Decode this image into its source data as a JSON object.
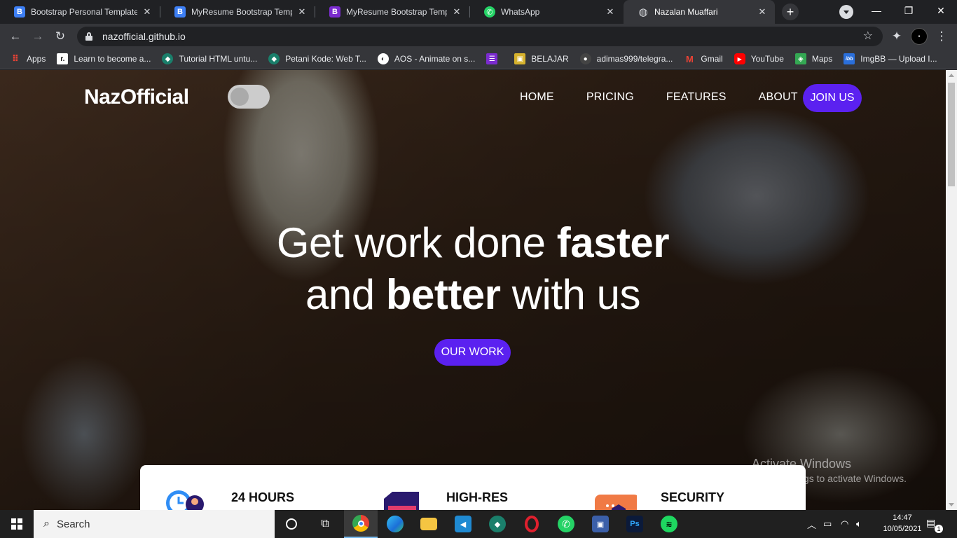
{
  "browser": {
    "tabs": [
      {
        "title": "Bootstrap Personal Templates",
        "favicon": "bootstrap-b-icon",
        "color": "#3d7ff5",
        "glyph": "B"
      },
      {
        "title": "MyResume Bootstrap Templa",
        "favicon": "bootstrap-b-icon",
        "color": "#3d7ff5",
        "glyph": "B"
      },
      {
        "title": "MyResume Bootstrap Templa",
        "favicon": "bootstrap-purple-icon",
        "color": "#7b2bcf",
        "glyph": "B"
      },
      {
        "title": "WhatsApp",
        "favicon": "whatsapp-icon",
        "color": "#25d366",
        "glyph": "✆"
      },
      {
        "title": "Nazalan Muaffari",
        "favicon": "globe-icon",
        "color": "#9aa0a6",
        "glyph": "◍"
      }
    ],
    "new_tab": "+",
    "window_controls": {
      "minimize": "—",
      "maximize": "❐",
      "close": "✕"
    },
    "url": "nazofficial.github.io",
    "bookmarks": [
      {
        "label": "Apps",
        "icon": "apps-grid-icon",
        "color": "#ea4335",
        "glyph": "⠿"
      },
      {
        "label": "Learn to become a...",
        "icon": "roadmap-icon",
        "color": "#111111",
        "glyph": "r."
      },
      {
        "label": "Tutorial HTML untu...",
        "icon": "petanikode-icon",
        "color": "#1a7f6b",
        "glyph": "◆"
      },
      {
        "label": "Petani Kode: Web T...",
        "icon": "petanikode-icon",
        "color": "#1a7f6b",
        "glyph": "◆"
      },
      {
        "label": "AOS - Animate on s...",
        "icon": "aos-icon",
        "color": "#555555",
        "glyph": "◐"
      },
      {
        "label": "",
        "icon": "list-icon",
        "color": "#7b2bcf",
        "glyph": "☰"
      },
      {
        "label": "BELAJAR",
        "icon": "folder-icon",
        "color": "#d6b22d",
        "glyph": "▣"
      },
      {
        "label": "adimas999/telegra...",
        "icon": "github-icon",
        "color": "#333333",
        "glyph": "●"
      },
      {
        "label": "Gmail",
        "icon": "gmail-icon",
        "color": "#ea4335",
        "glyph": "M"
      },
      {
        "label": "YouTube",
        "icon": "youtube-icon",
        "color": "#ff0000",
        "glyph": "▶"
      },
      {
        "label": "Maps",
        "icon": "maps-icon",
        "color": "#34a853",
        "glyph": "◈"
      },
      {
        "label": "ImgBB — Upload I...",
        "icon": "imgbb-icon",
        "color": "#2a6fdb",
        "glyph": "ibb"
      }
    ]
  },
  "site": {
    "brand": "NazOfficial",
    "nav": [
      "HOME",
      "PRICING",
      "FEATURES",
      "ABOUT"
    ],
    "join_label": "JOIN US",
    "hero": {
      "line1_light": "Get work done ",
      "line1_bold": "faster",
      "line2_a": "and ",
      "line2_bold": "better",
      "line2_b": " with us"
    },
    "cta_label": "OUR WORK",
    "features": [
      {
        "title": "24 HOURS",
        "icon": "clock-user-icon"
      },
      {
        "title": "HIGH-RES",
        "icon": "layers-icon"
      },
      {
        "title": "SECURITY",
        "icon": "shield-briefcase-icon"
      }
    ],
    "accent_color": "#5b21f0"
  },
  "watermark": {
    "line1": "Activate Windows",
    "line2": "Go to Settings to activate Windows."
  },
  "taskbar": {
    "search_placeholder": "Search",
    "apps": [
      {
        "name": "cortana-icon"
      },
      {
        "name": "task-view-icon"
      },
      {
        "name": "chrome-icon"
      },
      {
        "name": "edge-icon"
      },
      {
        "name": "file-explorer-icon"
      },
      {
        "name": "vscode-icon"
      },
      {
        "name": "petanikode-icon"
      },
      {
        "name": "opera-icon"
      },
      {
        "name": "whatsapp-icon"
      },
      {
        "name": "network-app-icon"
      },
      {
        "name": "photoshop-icon"
      },
      {
        "name": "spotify-icon"
      }
    ],
    "time": "14:47",
    "date": "10/05/2021",
    "notification_count": "1"
  }
}
